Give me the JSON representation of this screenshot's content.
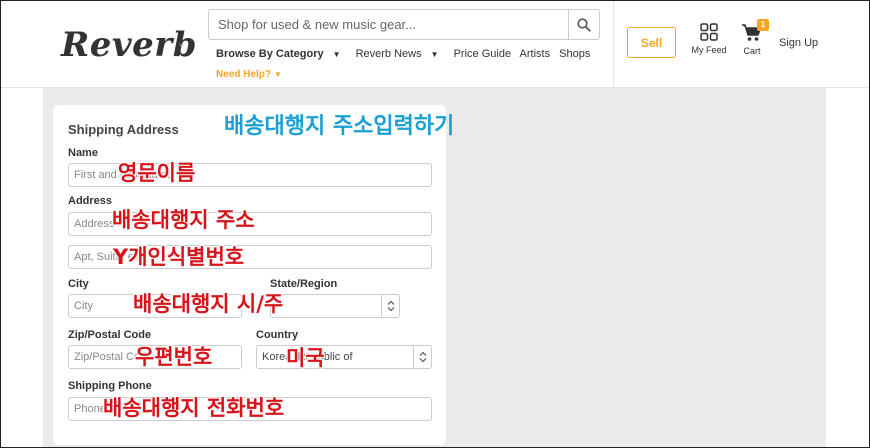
{
  "header": {
    "logo": "Reverb",
    "search_placeholder": "Shop for used & new music gear...",
    "nav": [
      "Browse By Category",
      "Reverb News",
      "Price Guide",
      "Artists",
      "Shops"
    ],
    "need_help": "Need Help?",
    "sell": "Sell",
    "my_feed": "My Feed",
    "cart": "Cart",
    "cart_count": "1",
    "sign_up": "Sign Up",
    "accent_color": "#f5a623"
  },
  "form": {
    "title": "Shipping Address",
    "name_label": "Name",
    "name_placeholder": "First and Last Name",
    "address_label": "Address",
    "address_placeholder": "Address",
    "address2_placeholder": "Apt, Suite, etc.",
    "city_label": "City",
    "city_placeholder": "City",
    "state_label": "State/Region",
    "zip_label": "Zip/Postal Code",
    "zip_placeholder": "Zip/Postal Code",
    "country_label": "Country",
    "country_value": "Korea, Republic of",
    "phone_label": "Shipping Phone",
    "phone_placeholder": "Phone"
  },
  "annotations": {
    "heading": "배송대행지 주소입력하기",
    "name": "영문이름",
    "address": "배송대행지 주소",
    "address2": "Y개인식별번호",
    "city": "배송대행지 시/주",
    "zip": "우편번호",
    "country": "미국",
    "phone": "배송대행지 전화번호",
    "red_color": "#d7141a",
    "blue_color": "#1a9fd6"
  }
}
